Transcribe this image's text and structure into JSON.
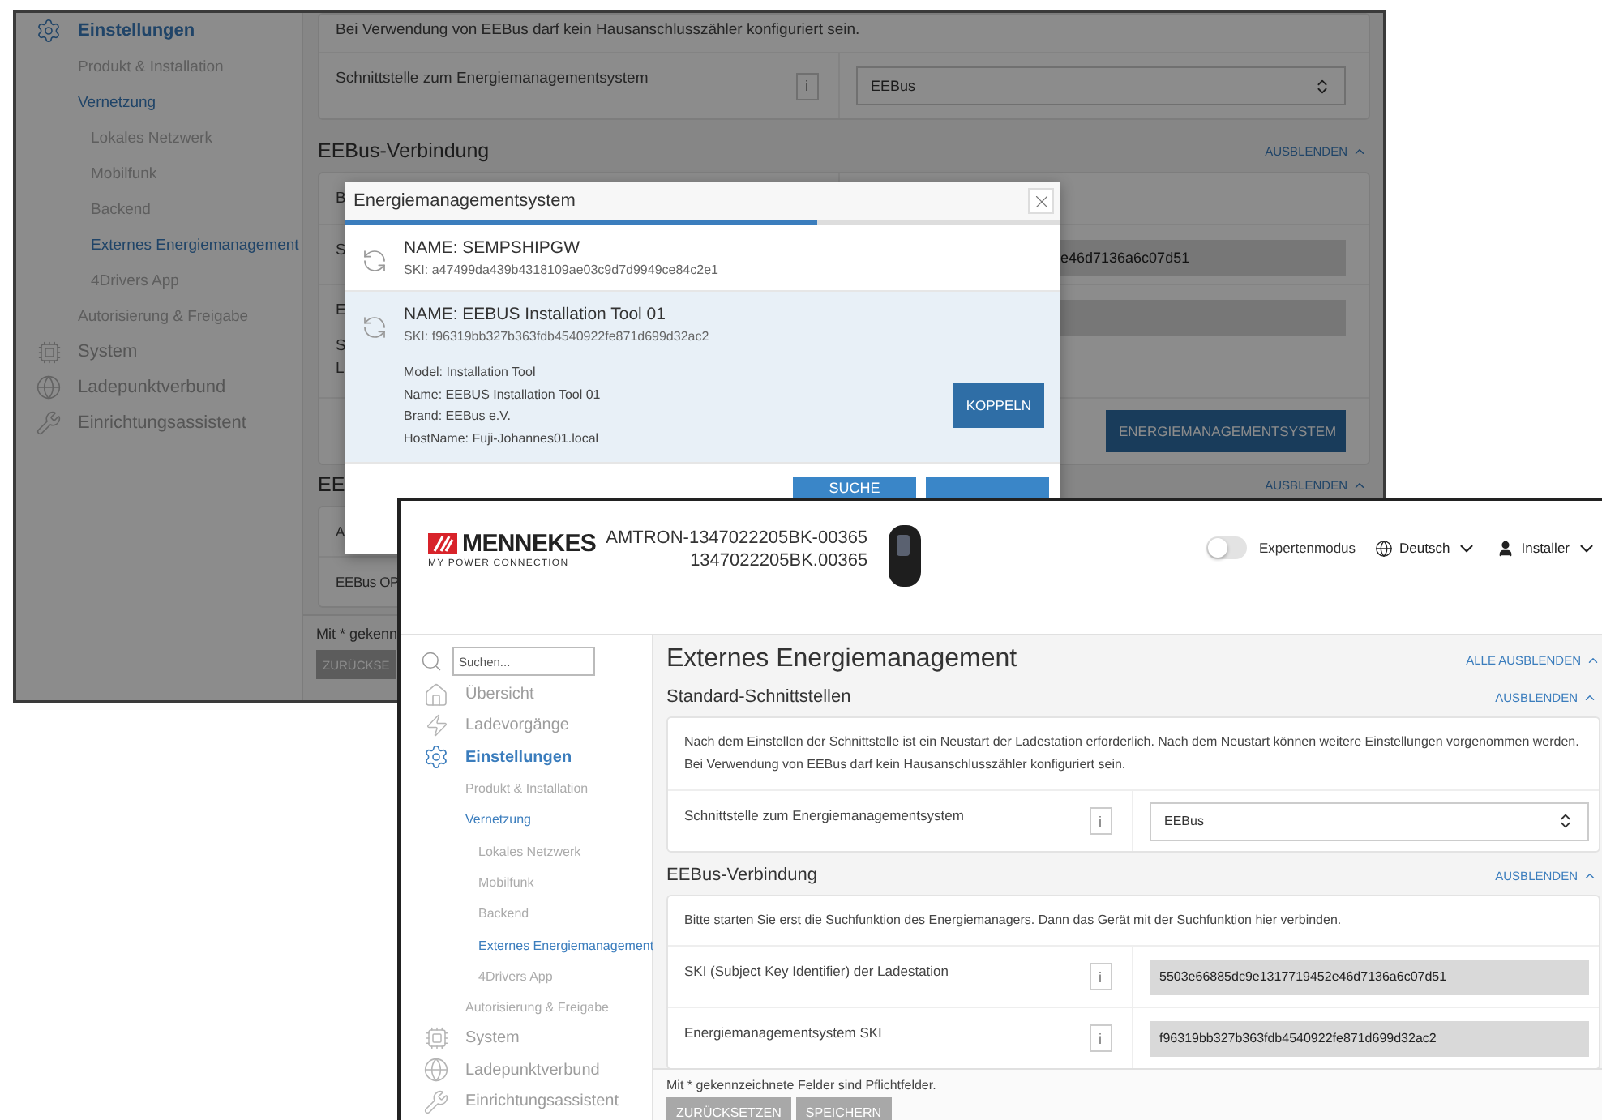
{
  "back_window": {
    "sidebar": [
      {
        "label": "Einstellungen",
        "selected": true,
        "children": [
          {
            "label": "Produkt & Installation",
            "selected": false
          },
          {
            "label": "Vernetzung",
            "selected": true,
            "children": [
              {
                "label": "Lokales Netzwerk",
                "selected": false
              },
              {
                "label": "Mobilfunk",
                "selected": false
              },
              {
                "label": "Backend",
                "selected": false
              },
              {
                "label": "Externes Energiemanagement",
                "selected": true
              },
              {
                "label": "4Drivers App",
                "selected": false
              }
            ]
          },
          {
            "label": "Autorisierung & Freigabe",
            "selected": false
          }
        ]
      },
      {
        "label": "System",
        "selected": false
      },
      {
        "label": "Ladepunktverbund",
        "selected": false
      },
      {
        "label": "Einrichtungsassistent",
        "selected": false
      }
    ],
    "notice": "Bei Verwendung von EEBus darf kein Hausanschlusszähler konfiguriert sein.",
    "interface_row": {
      "label": "Schnittstelle zum Energiemanagementsystem",
      "info": "i",
      "value": "EEBus"
    },
    "connection": {
      "title": "EEBus-Verbindung",
      "toggle": "AUSBLENDEN",
      "rows": [
        {
          "kind": "text",
          "label": "B"
        },
        {
          "kind": "field",
          "label": "S",
          "value": "e46d7136a6c07d51"
        },
        {
          "kind": "field",
          "label": "E",
          "lines": [
            "S",
            "L"
          ]
        },
        {
          "kind": "button",
          "button": "ENERGIEMANAGEMENTSYSTEM"
        }
      ]
    },
    "second_section": {
      "title": "EE",
      "toggle": "AUSBLENDEN",
      "rows": [
        "A",
        "EEBus OP"
      ]
    },
    "footer": {
      "note": "Mit * gekenn",
      "button": "ZURÜCKSE"
    },
    "dialog": {
      "title": "Energiemanagementsystem",
      "progress": {
        "level": 0.66
      },
      "devices": [
        {
          "name": "NAME: SEMPSHIPGW",
          "ski": "SKI: a47499da439b4318109ae03c9d7d9949ce84c2e1",
          "selected": false
        },
        {
          "name": "NAME: EEBUS Installation Tool 01",
          "ski": "SKI: f96319bb327b363fdb4540922fe871d699d32ac2",
          "selected": true,
          "details": [
            "Model: Installation Tool",
            "Name: EEBUS Installation Tool 01",
            "Brand: EEBus e.V.",
            "HostName: Fuji-Johannes01.local"
          ],
          "action": "KOPPELN"
        }
      ],
      "search_button": "SUCHE"
    }
  },
  "front_window": {
    "header": {
      "brand": "MENNEKES",
      "slogan": "MY POWER CONNECTION",
      "device_name": "AMTRON-1347022205BK-00365",
      "serial": "1347022205BK.00365",
      "expert_mode": {
        "label": "Expertenmodus",
        "on": false
      },
      "language": "Deutsch",
      "user": "Installer"
    },
    "search": {
      "placeholder": "Suchen..."
    },
    "sidebar": [
      {
        "label": "Übersicht",
        "selected": false
      },
      {
        "label": "Ladevorgänge",
        "selected": false
      },
      {
        "label": "Einstellungen",
        "selected": true,
        "children": [
          {
            "label": "Produkt & Installation",
            "selected": false
          },
          {
            "label": "Vernetzung",
            "selected": true,
            "children": [
              {
                "label": "Lokales Netzwerk",
                "selected": false
              },
              {
                "label": "Mobilfunk",
                "selected": false
              },
              {
                "label": "Backend",
                "selected": false
              },
              {
                "label": "Externes Energiemanagement",
                "selected": true
              },
              {
                "label": "4Drivers App",
                "selected": false
              }
            ]
          },
          {
            "label": "Autorisierung & Freigabe",
            "selected": false
          }
        ]
      },
      {
        "label": "System",
        "selected": false
      },
      {
        "label": "Ladepunktverbund",
        "selected": false
      },
      {
        "label": "Einrichtungsassistent",
        "selected": false
      }
    ],
    "page_title": "Externes Energiemanagement",
    "collapse_all": "ALLE AUSBLENDEN",
    "sections": [
      {
        "title": "Standard-Schnittstellen",
        "toggle": "AUSBLENDEN",
        "intro": [
          "Nach dem Einstellen der Schnittstelle ist ein Neustart der Ladestation erforderlich. Nach dem Neustart können weitere Einstellungen vorgenommen werden.",
          "Bei Verwendung von EEBus darf kein Hausanschlusszähler konfiguriert sein."
        ],
        "rows": [
          {
            "kind": "select",
            "label": "Schnittstelle zum Energiemanagementsystem",
            "info": "i",
            "value": "EEBus"
          }
        ]
      },
      {
        "title": "EEBus-Verbindung",
        "toggle": "AUSBLENDEN",
        "intro": [
          "Bitte starten Sie erst die Suchfunktion des Energiemanagers. Dann das Gerät mit der Suchfunktion hier verbinden."
        ],
        "rows": [
          {
            "kind": "readonly",
            "label": "SKI (Subject Key Identifier) der Ladestation",
            "info": "i",
            "value": "5503e66885dc9e1317719452e46d7136a6c07d51"
          },
          {
            "kind": "readonly",
            "label": "Energiemanagementsystem SKI",
            "info": "i",
            "value": "f96319bb327b363fdb4540922fe871d699d32ac2"
          }
        ]
      }
    ],
    "footer": {
      "note": "Mit * gekennzeichnete Felder sind Pflichtfelder.",
      "buttons": [
        {
          "label": "ZURÜCKSETZEN",
          "disabled": true
        },
        {
          "label": "SPEICHERN",
          "disabled": true
        }
      ]
    }
  }
}
